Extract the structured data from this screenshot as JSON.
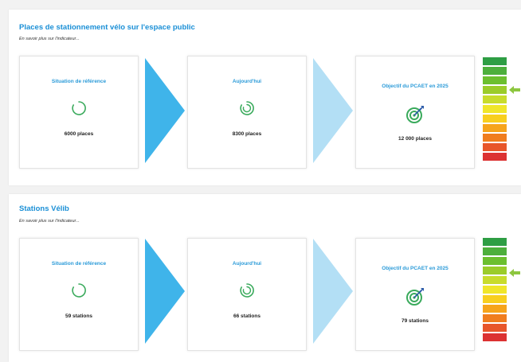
{
  "colors": {
    "title": "#1a8fd6",
    "arrow_dark": "#3fb4ea",
    "arrow_light": "#b3dff5",
    "icon_green": "#3aaa5c",
    "marker": "#8dc63f",
    "scale": [
      "#2e9e44",
      "#4daf3c",
      "#6cbf2f",
      "#9bcc2a",
      "#c8dc2c",
      "#f0e62a",
      "#f8cf1f",
      "#f6a41b",
      "#f07d1e",
      "#e8562a",
      "#dc3232"
    ]
  },
  "sections": [
    {
      "title": "Places de stationnement vélo sur l'espace public",
      "link": "En savoir plus sur l'indicateur...",
      "cards": [
        {
          "label": "Situation de référence",
          "icon": "progress-ring-icon",
          "value": "6000 places"
        },
        {
          "label": "Aujourd'hui",
          "icon": "progress-ring-icon",
          "value": "8300 places"
        },
        {
          "label": "Objectif du PCAET en 2025",
          "icon": "target-icon",
          "value": "12 000 places"
        }
      ]
    },
    {
      "title": "Stations Vélib",
      "link": "En savoir plus sur l'indicateur...",
      "cards": [
        {
          "label": "Situation de référence",
          "icon": "progress-ring-icon",
          "value": "59 stations"
        },
        {
          "label": "Aujourd'hui",
          "icon": "progress-ring-icon",
          "value": "66 stations"
        },
        {
          "label": "Objectif du PCAET en 2025",
          "icon": "target-icon",
          "value": "79 stations"
        }
      ]
    }
  ]
}
